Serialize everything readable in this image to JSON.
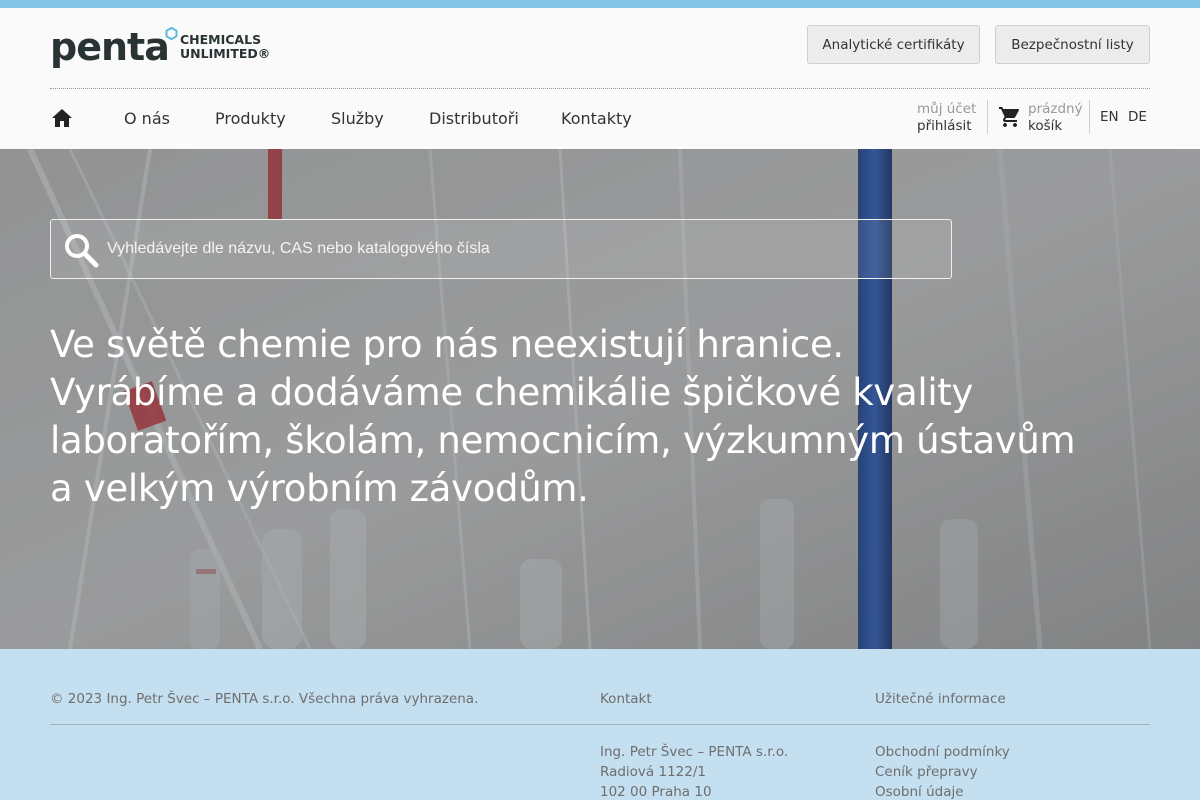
{
  "logo": {
    "word": "penta",
    "line1": "CHEMICALS",
    "line2": "UNLIMITED®"
  },
  "header": {
    "buttons": [
      {
        "label": "Analytické certifikáty"
      },
      {
        "label": "Bezpečnostní listy"
      }
    ],
    "nav": [
      {
        "label": "O nás"
      },
      {
        "label": "Produkty"
      },
      {
        "label": "Služby"
      },
      {
        "label": "Distributoři"
      },
      {
        "label": "Kontakty"
      }
    ],
    "account": {
      "top": "můj účet",
      "bottom": "přihlásit"
    },
    "cart": {
      "top": "prázdný",
      "bottom": "košík"
    },
    "languages": [
      "EN",
      "DE"
    ]
  },
  "hero": {
    "search_placeholder": "Vyhledávejte dle názvu, CAS nebo katalogového čísla",
    "lines": [
      "Ve světě chemie pro nás neexistují hranice.",
      "Vyrábíme a dodáváme chemikálie špičkové kvality",
      "laboratořím, školám, nemocnicím, výzkumným ústavům",
      "a velkým výrobním závodům."
    ]
  },
  "footer": {
    "copyright": "© 2023 Ing. Petr Švec – PENTA s.r.o. Všechna práva vyhrazena.",
    "contact": {
      "heading": "Kontakt",
      "lines": [
        "Ing. Petr Švec – PENTA s.r.o.",
        "Radiová 1122/1",
        "102 00 Praha 10"
      ]
    },
    "info": {
      "heading": "Užitečné informace",
      "links": [
        "Obchodní podmínky",
        "Ceník přepravy",
        "Osobní údaje"
      ]
    }
  },
  "colors": {
    "topbar": "#84c4e6",
    "logo_hex": "#5db8dc",
    "footer_bg": "#c4dff0"
  },
  "icons": {
    "home": "home-icon",
    "cart": "cart-icon",
    "search": "search-icon"
  }
}
